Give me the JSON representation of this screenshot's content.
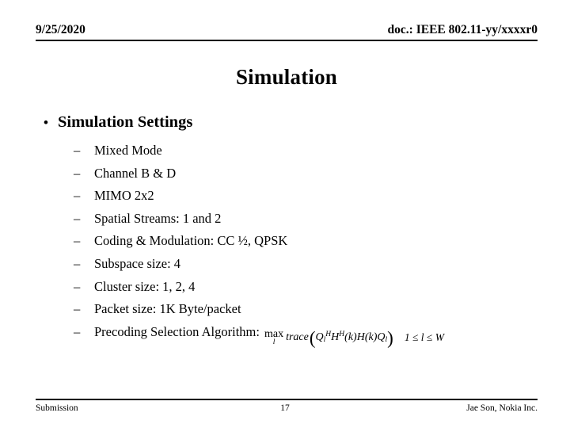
{
  "header": {
    "date": "9/25/2020",
    "doc_reference": "doc.: IEEE 802.11-yy/xxxxr0"
  },
  "title": "Simulation",
  "outline": {
    "level1_bullet_glyph": "•",
    "level1_label": "Simulation Settings",
    "level2_bullet_glyph": "–",
    "items": [
      {
        "label": "Mixed Mode"
      },
      {
        "label": "Channel B & D"
      },
      {
        "label": "MIMO 2x2"
      },
      {
        "label": "Spatial Streams: 1 and 2"
      },
      {
        "label": "Coding & Modulation: CC ½, QPSK"
      },
      {
        "label": "Subspace size: 4"
      },
      {
        "label": "Cluster size: 1, 2, 4"
      },
      {
        "label": "Packet size: 1K Byte/packet"
      },
      {
        "label": "Precoding Selection Algorithm:"
      }
    ]
  },
  "equation": {
    "operator": "max",
    "operator_subscript": "l",
    "function": "trace",
    "open_paren": "(",
    "close_paren": ")",
    "term1_base": "Q",
    "term1_sub": "l",
    "term1_sup": "H",
    "term2_base": "H",
    "term2_sup": "H",
    "term2_arg": "(k)",
    "term3_base": "H",
    "term3_arg": "(k)",
    "term4_base": "Q",
    "term4_sub": "l",
    "condition_left": "1",
    "condition_rel1": "≤",
    "condition_var": "l",
    "condition_rel2": "≤",
    "condition_right": "W"
  },
  "footer": {
    "left": "Submission",
    "page_number": "17",
    "right": "Jae Son, Nokia Inc."
  }
}
